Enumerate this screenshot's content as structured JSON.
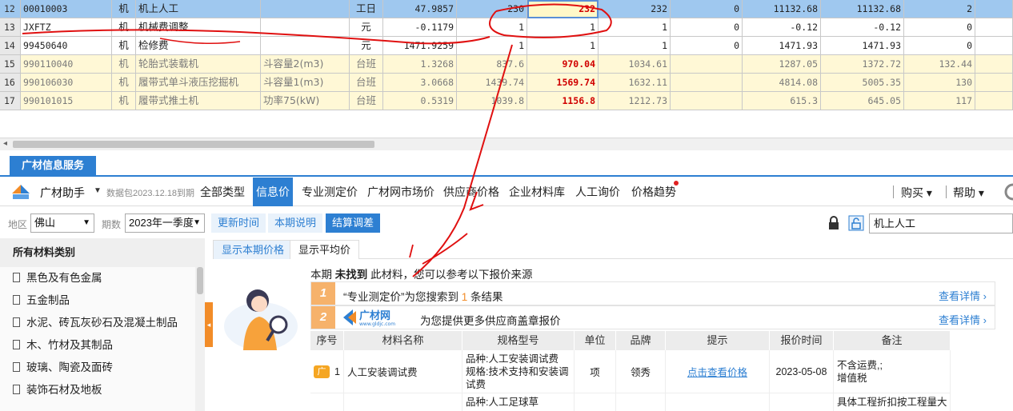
{
  "grid": {
    "rows": [
      {
        "rownum": "12",
        "code": "00010003",
        "type": "机",
        "name": "机上人工",
        "spec": "",
        "unit": "工日",
        "price": "47.9857",
        "qty1": "230",
        "qty2": "232",
        "qty3": "232",
        "v1": "0",
        "v2": "11132.68",
        "v3": "11132.68",
        "v4": "2",
        "style": "sel"
      },
      {
        "rownum": "13",
        "code": "JXFTZ",
        "type": "机",
        "name": "机械费调整",
        "spec": "",
        "unit": "元",
        "price": "-0.1179",
        "qty1": "1",
        "qty2": "1",
        "qty3": "1",
        "v1": "0",
        "v2": "-0.12",
        "v3": "-0.12",
        "v4": "0",
        "style": "white"
      },
      {
        "rownum": "14",
        "code": "99450640",
        "type": "机",
        "name": "检修费",
        "spec": "",
        "unit": "元",
        "price": "1471.9259",
        "qty1": "1",
        "qty2": "1",
        "qty3": "1",
        "v1": "0",
        "v2": "1471.93",
        "v3": "1471.93",
        "v4": "0",
        "style": "white"
      },
      {
        "rownum": "15",
        "code": "990110040",
        "type": "机",
        "name": "轮胎式装载机",
        "spec": "斗容量2(m3)",
        "unit": "台班",
        "price": "1.3268",
        "qty1": "837.6",
        "qty2": "970.04",
        "qty3": "1034.61",
        "v1": "",
        "v2": "1287.05",
        "v3": "1372.72",
        "v4": "132.44",
        "style": "yel"
      },
      {
        "rownum": "16",
        "code": "990106030",
        "type": "机",
        "name": "履带式单斗液压挖掘机",
        "spec": "斗容量1(m3)",
        "unit": "台班",
        "price": "3.0668",
        "qty1": "1439.74",
        "qty2": "1569.74",
        "qty3": "1632.11",
        "v1": "",
        "v2": "4814.08",
        "v3": "5005.35",
        "v4": "130",
        "style": "yel"
      },
      {
        "rownum": "17",
        "code": "990101015",
        "type": "机",
        "name": "履带式推土机",
        "spec": "功率75(kW)",
        "unit": "台班",
        "price": "0.5319",
        "qty1": "1039.8",
        "qty2": "1156.8",
        "qty3": "1212.73",
        "v1": "",
        "v2": "615.3",
        "v3": "645.05",
        "v4": "117",
        "style": "yel"
      }
    ]
  },
  "service_tab": "广材信息服务",
  "nav": {
    "brand": "广材助手",
    "package_info": "数据包2023.12.18到期",
    "tabs": [
      "全部类型",
      "信息价",
      "专业测定价",
      "广材网市场价",
      "供应商价格",
      "企业材料库",
      "人工询价",
      "价格趋势"
    ],
    "buy": "购买",
    "help": "帮助"
  },
  "filter": {
    "region_label": "地区",
    "region_value": "佛山",
    "period_label": "期数",
    "period_value": "2023年一季度",
    "btn_update": "更新时间",
    "btn_explain": "本期说明",
    "btn_adjust": "结算调差",
    "search_value": "机上人工"
  },
  "sidebar": {
    "title": "所有材料类别",
    "items": [
      "黑色及有色金属",
      "五金制品",
      "水泥、砖瓦灰砂石及混凝土制品",
      "木、竹材及其制品",
      "玻璃、陶瓷及面砖",
      "装饰石材及地板"
    ]
  },
  "content": {
    "subtabs": [
      "显示本期价格",
      "显示平均价"
    ],
    "notice_pre": "本期",
    "notice_bold": "未找到",
    "notice_post": "此材料，您可以参考以下报价来源",
    "result1_num": "1",
    "result1_pre": "“专业测定价”为您搜索到",
    "result1_count": "1",
    "result1_post": "条结果",
    "result2_num": "2",
    "result2_brand": "广材网",
    "result2_brand_url": "www.gldjc.com",
    "result2_text": "为您提供更多供应商盖章报价",
    "more": "查看详情 ›",
    "table": {
      "headers": [
        "序号",
        "材料名称",
        "规格型号",
        "单位",
        "品牌",
        "提示",
        "报价时间",
        "备注"
      ],
      "rows": [
        {
          "badge": "广",
          "idx": "1",
          "name": "人工安装调试费",
          "spec": "品种:人工安装调试费\n规格:技术支持和安装调试费",
          "unit": "项",
          "brand": "领秀",
          "hint": "点击查看价格",
          "date": "2023-05-08",
          "note": "不含运费,;\n增值税"
        },
        {
          "badge": "",
          "idx": "",
          "name": "",
          "spec": "品种:人工足球草",
          "unit": "",
          "brand": "",
          "hint": "",
          "date": "",
          "note": "具体工程折扣按工程量大"
        }
      ]
    }
  },
  "colors": {
    "accent": "#2d7fd2",
    "orange": "#f28c28",
    "red_highlight": "#d00000",
    "selected_row": "#9fc8ef",
    "annotation_red": "#e01010"
  }
}
